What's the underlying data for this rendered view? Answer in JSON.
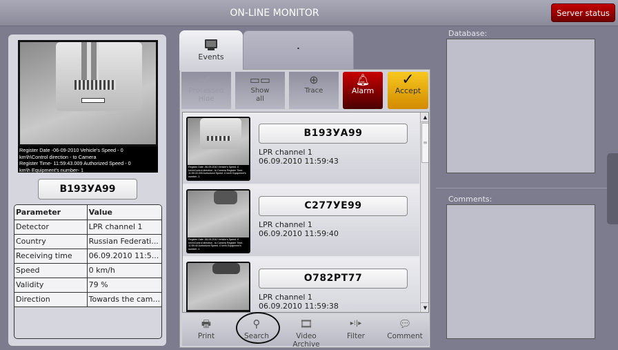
{
  "header": {
    "title": "ON-LINE MONITOR",
    "server_status": "Server status"
  },
  "camera": {
    "caption": [
      "Register Date -06-09-2010     Vehicle's Speed - 0",
      "km\\h\\Control direction - to Camera",
      "Register Time- 11:59:43.009  Authorized Speed - 0",
      "km\\h     Equipment's number- 1"
    ]
  },
  "selected_plate": "B193УA99",
  "params": {
    "headers": [
      "Parameter",
      "Value"
    ],
    "rows": [
      [
        "Detector",
        "LPR channel 1"
      ],
      [
        "Country",
        "Russian Federati..."
      ],
      [
        "Receiving time",
        "06.09.2010 11:5..."
      ],
      [
        "Speed",
        "0 km/h"
      ],
      [
        "Validity",
        "79 %"
      ],
      [
        "Direction",
        "Towards the cam..."
      ]
    ]
  },
  "tabs": [
    {
      "label": "Events"
    },
    {
      "label": "."
    }
  ],
  "toolbar": {
    "processed_hide": "Processed\nHide",
    "show_all": "Show\nall",
    "trace": "Trace",
    "alarm": "Alarm",
    "accept": "Accept"
  },
  "events": [
    {
      "plate": "B193УA99",
      "detector": "LPR channel 1",
      "time": "06.09.2010 11:59:43"
    },
    {
      "plate": "C277УE99",
      "detector": "LPR channel 1",
      "time": "06.09.2010 11:59:40"
    },
    {
      "plate": "O782PT77",
      "detector": "LPR channel 1",
      "time": "06.09.2010 11:59:38"
    }
  ],
  "bottom": {
    "print": "Print",
    "search": "Search",
    "video_archive": "Video Archive",
    "filter": "Filter",
    "comment": "Comment"
  },
  "right": {
    "database": "Database:",
    "comments": "Comments:"
  }
}
